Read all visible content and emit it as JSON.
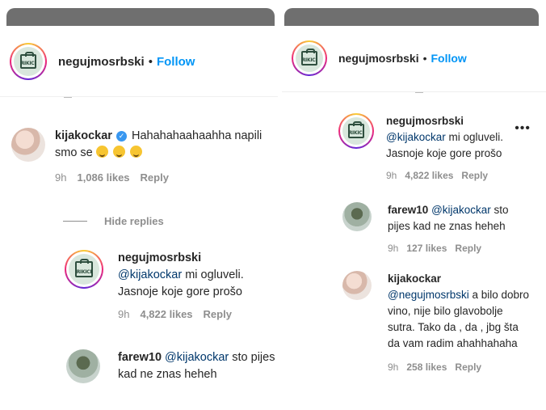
{
  "left": {
    "header": {
      "username": "negujmosrbski",
      "separator": "•",
      "follow_label": "Follow",
      "logo_text": "RIKICI"
    },
    "comments": [
      {
        "user": "kijakockar",
        "verified": true,
        "text": "Hahahahaahaahha napili smo se",
        "time": "9h",
        "likes": "1,086 likes",
        "reply": "Reply"
      }
    ],
    "hide_replies": "Hide replies",
    "replies": [
      {
        "user": "negujmosrbski",
        "mention": "@kijakockar",
        "text": " mi ogluveli. Jasnoje koje gore prošo",
        "time": "9h",
        "likes": "4,822 likes",
        "reply": "Reply"
      },
      {
        "user": "farew10",
        "mention": "@kijakockar",
        "text": " sto pijes kad ne znas heheh"
      }
    ]
  },
  "right": {
    "header": {
      "username": "negujmosrbski",
      "separator": "•",
      "follow_label": "Follow",
      "logo_text": "RIKICI"
    },
    "more_icon": "•••",
    "comments": [
      {
        "user": "negujmosrbski",
        "mention": "@kijakockar",
        "text": " mi ogluveli. Jasnoje koje gore prošo",
        "time": "9h",
        "likes": "4,822 likes",
        "reply": "Reply"
      },
      {
        "user": "farew10",
        "mention": "@kijakockar",
        "text": " sto pijes kad ne znas heheh",
        "time": "9h",
        "likes": "127 likes",
        "reply": "Reply"
      },
      {
        "user": "kijakockar",
        "mention": "@negujmosrbski",
        "text": " a bilo dobro vino, nije bilo glavobolje sutra. Tako da , da , jbg šta da vam radim ahahhahaha",
        "time": "9h",
        "likes": "258 likes",
        "reply": "Reply"
      }
    ]
  },
  "colors": {
    "follow": "#0095f6",
    "mention": "#00376b",
    "meta": "#8e8e8e",
    "verified": "#3897f0"
  }
}
